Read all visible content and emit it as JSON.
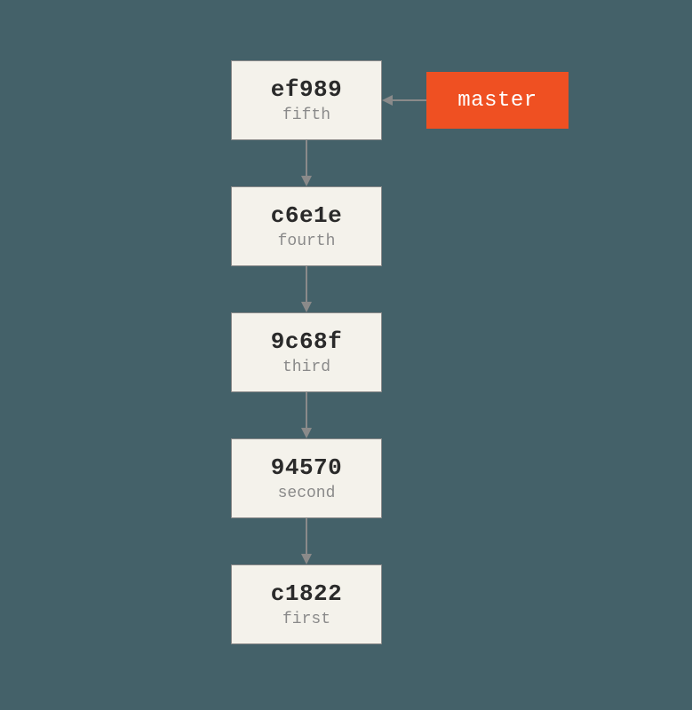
{
  "commits": [
    {
      "hash": "ef989",
      "message": "fifth"
    },
    {
      "hash": "c6e1e",
      "message": "fourth"
    },
    {
      "hash": "9c68f",
      "message": "third"
    },
    {
      "hash": "94570",
      "message": "second"
    },
    {
      "hash": "c1822",
      "message": "first"
    }
  ],
  "branch": {
    "name": "master"
  },
  "colors": {
    "background": "#446169",
    "box_bg": "#f4f2eb",
    "box_border": "#8a8a8a",
    "branch_bg": "#ef5022",
    "arrow": "#8a8a8a"
  }
}
